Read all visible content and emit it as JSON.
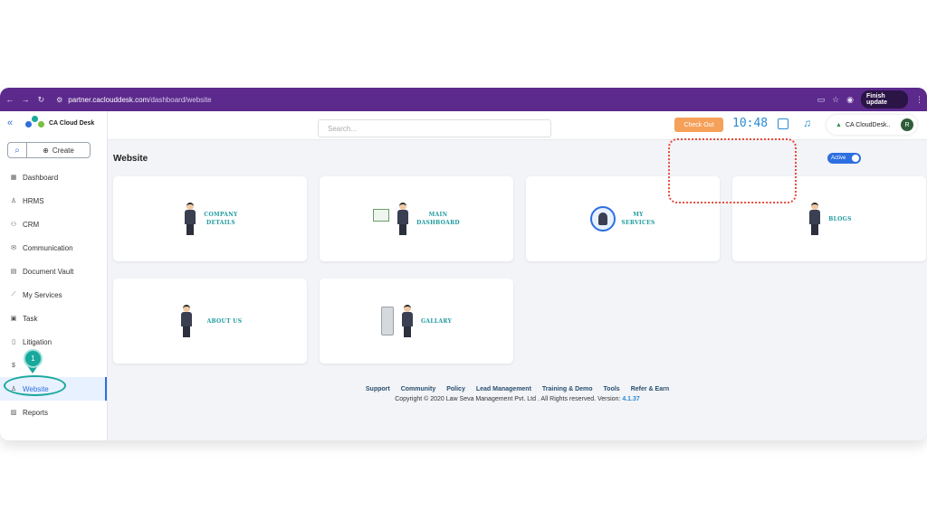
{
  "browser": {
    "url_host": "partner.caclouddesk.com",
    "url_path": "/dashboard/website",
    "finish_update_label": "Finish update"
  },
  "sidebar": {
    "brand": "CA Cloud Desk",
    "create_label": "Create",
    "items": [
      {
        "label": "Dashboard",
        "icon": "grid-icon"
      },
      {
        "label": "HRMS",
        "icon": "user-icon"
      },
      {
        "label": "CRM",
        "icon": "users-icon"
      },
      {
        "label": "Communication",
        "icon": "mail-icon"
      },
      {
        "label": "Document Vault",
        "icon": "document-icon"
      },
      {
        "label": "My Services",
        "icon": "chart-icon"
      },
      {
        "label": "Task",
        "icon": "clipboard-icon"
      },
      {
        "label": "Litigation",
        "icon": "file-icon"
      },
      {
        "label": "",
        "icon": "dollar-icon"
      },
      {
        "label": "Website",
        "icon": "user-icon",
        "active": true
      },
      {
        "label": "Reports",
        "icon": "report-icon"
      }
    ]
  },
  "topbar": {
    "search_placeholder": "Search...",
    "checkout_label": "Check Out",
    "clock": "10:48",
    "firm_name": "CA CloudDesk..",
    "avatar_initial": "R"
  },
  "main": {
    "title": "Website",
    "toggle_label": "Active",
    "cards": [
      {
        "line1": "COMPANY",
        "line2": "DETAILS"
      },
      {
        "line1": "MAIN",
        "line2": "DASHBOARD"
      },
      {
        "line1": "MY",
        "line2": "SERVICES"
      },
      {
        "line1": "BLOGS",
        "line2": ""
      },
      {
        "line1": "ABOUT US",
        "line2": ""
      },
      {
        "line1": "GALLARY",
        "line2": ""
      }
    ]
  },
  "footer": {
    "links": [
      "Support",
      "Community",
      "Policy",
      "Lead Management",
      "Training & Demo",
      "Tools",
      "Refer & Earn"
    ],
    "copyright": "Copyright © 2020 Law Seva Management Pvt. Ltd . All Rights reserved.",
    "version_label": "Version:",
    "version": "4.1.37"
  },
  "callout": {
    "step": "1"
  },
  "colors": {
    "chrome": "#5b2a8c",
    "accent": "#2d6fe0",
    "checkout": "#f5a15a",
    "teal": "#18a89c",
    "highlight": "#e74c3c"
  }
}
